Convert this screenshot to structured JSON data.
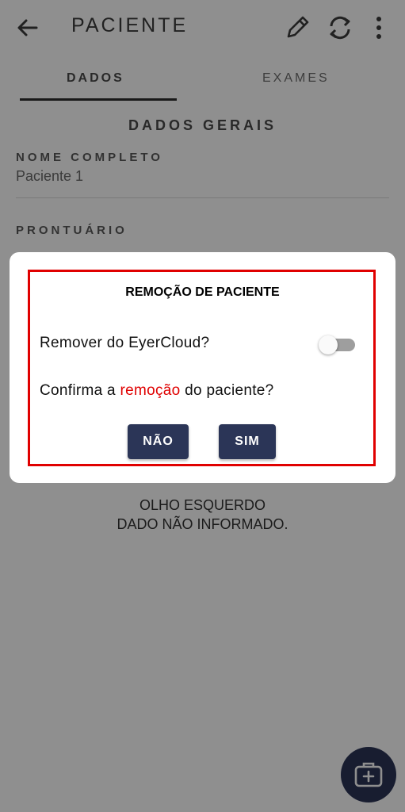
{
  "header": {
    "title": "PACIENTE",
    "icons": [
      "arrow-back-icon",
      "pencil-icon",
      "sync-icon",
      "more-vert-icon"
    ]
  },
  "tabs": [
    {
      "label": "DADOS",
      "active": true
    },
    {
      "label": "EXAMES",
      "active": false
    }
  ],
  "section": {
    "title": "DADOS GERAIS",
    "fields": [
      {
        "label": "NOME COMPLETO",
        "value": "Paciente 1"
      },
      {
        "label": "PRONTUÁRIO",
        "value": ""
      }
    ]
  },
  "eye": {
    "label": "OLHO ESQUERDO",
    "value": "DADO NÃO INFORMADO."
  },
  "dialog": {
    "title": "REMOÇÃO DE PACIENTE",
    "toggle_label": "Remover do EyerCloud?",
    "toggle_on": false,
    "confirm_before": "Confirma a ",
    "confirm_highlight": "remoção",
    "confirm_after": " do paciente?",
    "no_label": "NÃO",
    "yes_label": "SIM"
  },
  "fab": {
    "icon": "medical-kit-icon"
  },
  "colors": {
    "primary": "#2b3557",
    "highlight": "#e00000",
    "scrim": "rgba(0,0,0,0.44)"
  }
}
